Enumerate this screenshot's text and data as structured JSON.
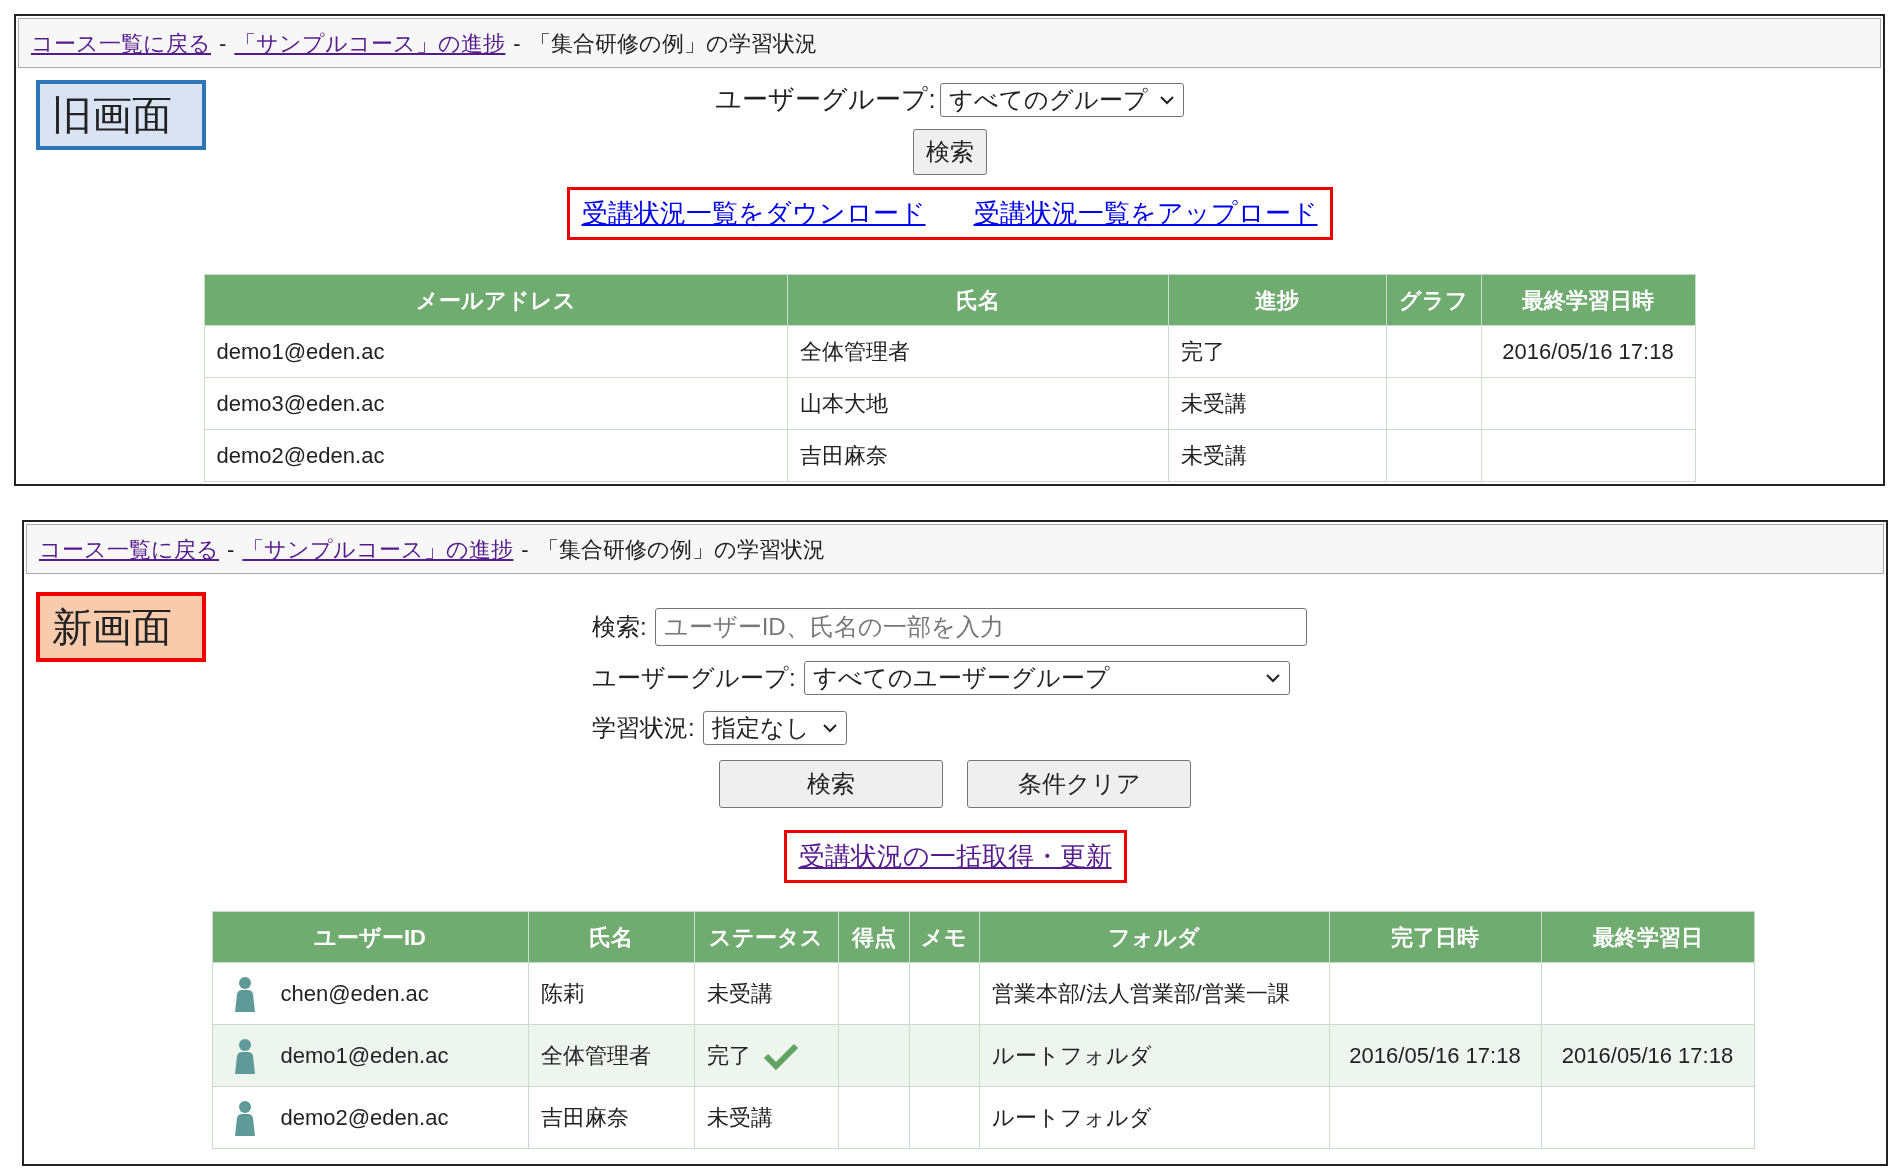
{
  "old_screen": {
    "breadcrumb": {
      "links": [
        {
          "text": "コース一覧に戻る",
          "visited": true
        },
        {
          "text": "「サンプルコース」の進捗",
          "visited": true
        }
      ],
      "separator": "-",
      "current": "「集合研修の例」の学習状況"
    },
    "label": "旧画面",
    "group_filter": {
      "label": "ユーザーグループ:",
      "value": "すべてのグループ"
    },
    "search_button": "検索",
    "links": [
      {
        "text": "受講状況一覧をダウンロード",
        "visited": false
      },
      {
        "text": "受講状況一覧をアップロード",
        "visited": false
      }
    ],
    "table": {
      "columns": [
        "メールアドレス",
        "氏名",
        "進捗",
        "グラフ",
        "最終学習日時"
      ],
      "rows": [
        {
          "cells": [
            "demo1@eden.ac",
            "全体管理者",
            "完了",
            "",
            "2016/05/16 17:18"
          ]
        },
        {
          "cells": [
            "demo3@eden.ac",
            "山本大地",
            "未受講",
            "",
            ""
          ]
        },
        {
          "cells": [
            "demo2@eden.ac",
            "吉田麻奈",
            "未受講",
            "",
            ""
          ]
        }
      ]
    }
  },
  "new_screen": {
    "breadcrumb": {
      "links": [
        {
          "text": "コース一覧に戻る",
          "visited": true
        },
        {
          "text": "「サンプルコース」の進捗",
          "visited": true
        }
      ],
      "separator": "-",
      "current": "「集合研修の例」の学習状況"
    },
    "label": "新画面",
    "search": {
      "label": "検索:",
      "placeholder": "ユーザーID、氏名の一部を入力"
    },
    "group_filter": {
      "label": "ユーザーグループ:",
      "value": "すべてのユーザーグループ"
    },
    "status_filter": {
      "label": "学習状況:",
      "value": "指定なし"
    },
    "buttons": [
      "検索",
      "条件クリア"
    ],
    "link": {
      "text": "受講状況の一括取得・更新",
      "visited": true
    },
    "table": {
      "columns": [
        "ユーザーID",
        "氏名",
        "ステータス",
        "得点",
        "メモ",
        "フォルダ",
        "完了日時",
        "最終学習日"
      ],
      "rows": [
        {
          "completed": false,
          "cells": [
            "chen@eden.ac",
            "陈莉",
            "未受講",
            "",
            "",
            "営業本部/法人営業部/営業一課",
            "",
            ""
          ]
        },
        {
          "completed": true,
          "cells": [
            "demo1@eden.ac",
            "全体管理者",
            "完了",
            "",
            "",
            "ルートフォルダ",
            "2016/05/16 17:18",
            "2016/05/16 17:18"
          ]
        },
        {
          "completed": false,
          "cells": [
            "demo2@eden.ac",
            "吉田麻奈",
            "未受講",
            "",
            "",
            "ルートフォルダ",
            "",
            ""
          ]
        }
      ]
    }
  }
}
